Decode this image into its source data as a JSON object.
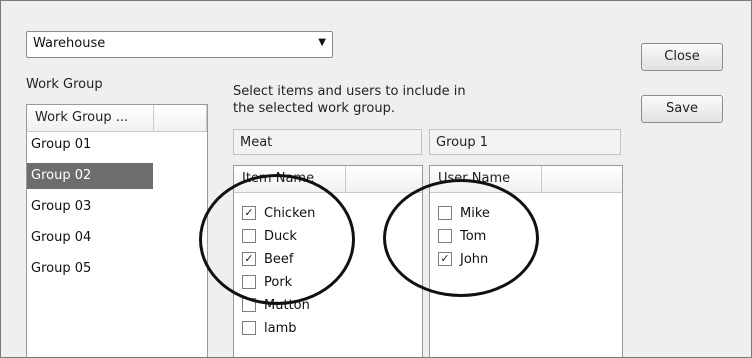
{
  "warehouse_select": {
    "value": "Warehouse"
  },
  "buttons": {
    "close": "Close",
    "save": "Save"
  },
  "work_group": {
    "label": "Work Group",
    "column_header": "Work Group ...",
    "items": [
      "Group 01",
      "Group 02",
      "Group 03",
      "Group 04",
      "Group 05"
    ],
    "selected_index": 1
  },
  "instructions": {
    "line1": "Select items and users to include in",
    "line2": "the selected work group."
  },
  "selected_category": "Meat",
  "selected_group": "Group 1",
  "items_list": {
    "header": "Item Name",
    "rows": [
      {
        "name": "Chicken",
        "checked": true
      },
      {
        "name": "Duck",
        "checked": false
      },
      {
        "name": "Beef",
        "checked": true
      },
      {
        "name": "Pork",
        "checked": false
      },
      {
        "name": "Mutton",
        "checked": false
      },
      {
        "name": "lamb",
        "checked": false
      }
    ]
  },
  "users_list": {
    "header": "User Name",
    "rows": [
      {
        "name": "Mike",
        "checked": false
      },
      {
        "name": "Tom",
        "checked": false
      },
      {
        "name": "John",
        "checked": true
      }
    ]
  },
  "icons": {
    "dropdown_arrow": "triangle-down",
    "check": "check-mark"
  }
}
